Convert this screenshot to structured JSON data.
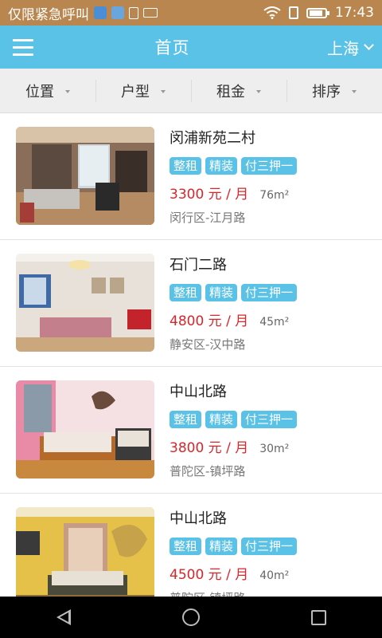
{
  "status_bar": {
    "carrier": "仅限紧急呼叫",
    "time": "17:43",
    "icons": [
      "app-icon",
      "app-icon-2",
      "sim-icon",
      "keyboard-icon",
      "wifi-icon",
      "sim-card-icon",
      "battery-icon"
    ]
  },
  "app_bar": {
    "title": "首页",
    "city": "上海",
    "menu_icon": "hamburger-menu-icon",
    "city_icon": "chevron-down-icon"
  },
  "filters": [
    {
      "label": "位置"
    },
    {
      "label": "户型"
    },
    {
      "label": "租金"
    },
    {
      "label": "排序"
    }
  ],
  "listings": [
    {
      "name": "闵浦新苑二村",
      "tags": [
        "整租",
        "精装",
        "付三押一"
      ],
      "price": "3300 元 / 月",
      "area": "76m²",
      "address": "闵行区-江月路"
    },
    {
      "name": "石门二路",
      "tags": [
        "整租",
        "精装",
        "付三押一"
      ],
      "price": "4800 元 / 月",
      "area": "45m²",
      "address": "静安区-汉中路"
    },
    {
      "name": "中山北路",
      "tags": [
        "整租",
        "精装",
        "付三押一"
      ],
      "price": "3800 元 / 月",
      "area": "30m²",
      "address": "普陀区-镇坪路"
    },
    {
      "name": "中山北路",
      "tags": [
        "整租",
        "精装",
        "付三押一"
      ],
      "price": "4500 元 / 月",
      "area": "40m²",
      "address": "普陀区-镇坪路"
    }
  ],
  "colors": {
    "status_bar": "#b8864e",
    "app_bar": "#5bc2e7",
    "tag": "#5bc2e7",
    "price": "#d9262b"
  },
  "nav_bar": {
    "icons": [
      "back-icon",
      "home-icon",
      "recent-apps-icon"
    ]
  }
}
